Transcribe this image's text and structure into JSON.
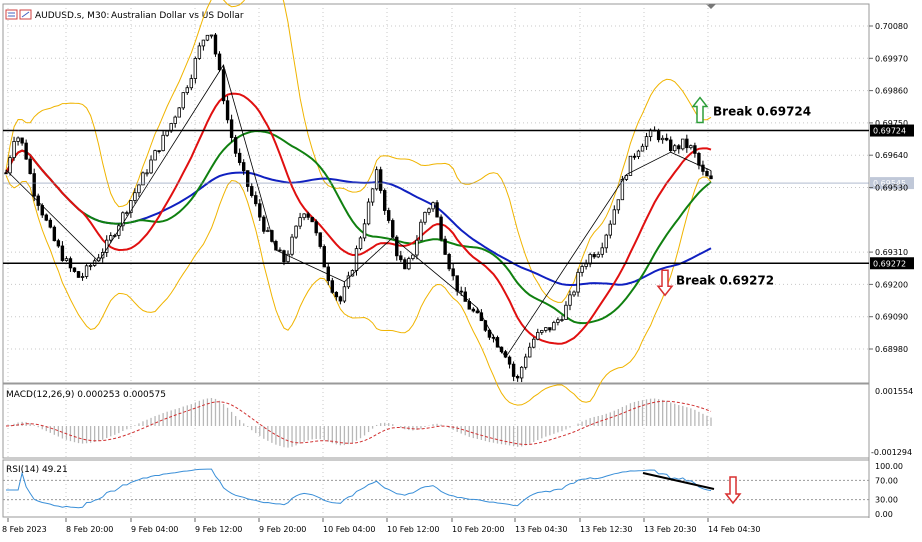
{
  "header": {
    "symbol": "AUDUSD.s, M30:",
    "description": "Australian Dollar vs US Dollar"
  },
  "price_axis": {
    "labels": [
      "0.70080",
      "0.69970",
      "0.69860",
      "0.69750",
      "0.69640",
      "0.69530",
      "0.69310",
      "0.69200",
      "0.69090",
      "0.68980"
    ],
    "levels": [
      0.7008,
      0.6997,
      0.6986,
      0.6975,
      0.6964,
      0.6953,
      0.6931,
      0.692,
      0.6909,
      0.6898
    ]
  },
  "levels": [
    {
      "name": "resistance",
      "value": 0.69724,
      "tag": "0.69724",
      "annotation": "Break 0.69724",
      "arrow": "up",
      "color": "#2e9e3a"
    },
    {
      "name": "support",
      "value": 0.69272,
      "tag": "0.69272",
      "annotation": "Break 0.69272",
      "arrow": "down",
      "color": "#d83030"
    }
  ],
  "current_price": {
    "value": 0.69545,
    "tag": "0.69545"
  },
  "macd": {
    "label": "MACD(12,26,9) 0.000253 0.000575",
    "axis_labels": [
      "0.001554",
      "-0.001294"
    ]
  },
  "rsi": {
    "label": "RSI(14) 49.21",
    "axis_labels": [
      "100.00",
      "70.00",
      "30.00",
      "0.00"
    ],
    "levels": [
      100,
      70,
      30,
      0
    ]
  },
  "time_axis": {
    "labels": [
      "8 Feb 2023",
      "8 Feb 20:00",
      "9 Feb 04:00",
      "9 Feb 12:00",
      "9 Feb 20:00",
      "10 Feb 04:00",
      "10 Feb 12:00",
      "10 Feb 20:00",
      "13 Feb 04:30",
      "13 Feb 12:30",
      "13 Feb 20:30",
      "14 Feb 04:30"
    ]
  },
  "colors": {
    "candle": "#000000",
    "ma_fast": "#e01010",
    "ma_mid": "#108010",
    "ma_slow": "#1020c0",
    "bollinger": "#f0b400",
    "macd_hist": "#b8b8b8",
    "macd_signal": "#d03030",
    "rsi": "#3a8fd8",
    "grid": "#c8c8c8"
  },
  "chart_data": {
    "type": "candlestick",
    "series_names": [],
    "y_price_key": [
      0.6958,
      0.6972,
      0.6966,
      0.6952,
      0.6944,
      0.6936,
      0.693,
      0.6925,
      0.6922,
      0.6926,
      0.693,
      0.6934,
      0.694,
      0.6946,
      0.6952,
      0.6958,
      0.6964,
      0.697,
      0.6976,
      0.6984,
      0.6992,
      0.7002,
      0.7008,
      0.6992,
      0.6974,
      0.6962,
      0.6954,
      0.6946,
      0.6938,
      0.6932,
      0.6928,
      0.6936,
      0.6946,
      0.6942,
      0.693,
      0.692,
      0.6914,
      0.6922,
      0.6934,
      0.6946,
      0.6958,
      0.6944,
      0.6932,
      0.6924,
      0.6932,
      0.6944,
      0.6948,
      0.6936,
      0.6924,
      0.6916,
      0.6912,
      0.6908,
      0.6904,
      0.69,
      0.6896,
      0.6886,
      0.6896,
      0.6902,
      0.6904,
      0.6906,
      0.691,
      0.6916,
      0.6926,
      0.693,
      0.6932,
      0.694,
      0.695,
      0.696,
      0.6966,
      0.697,
      0.6972,
      0.6968,
      0.6966,
      0.6968,
      0.6966,
      0.6958,
      0.6955
    ],
    "annotations": [
      "Break 0.69724",
      "Break 0.69272"
    ]
  }
}
